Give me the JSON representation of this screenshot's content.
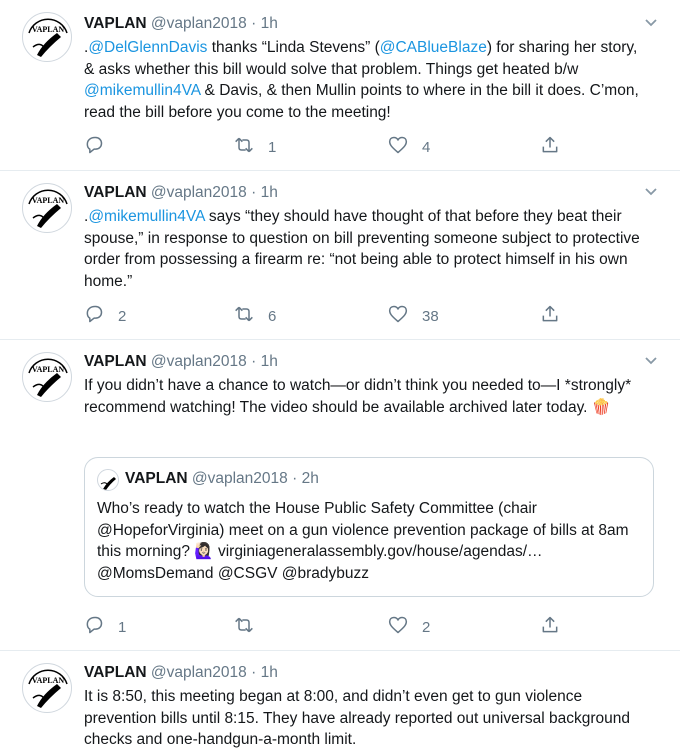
{
  "tweets": [
    {
      "name": "VAPLAN",
      "handle": "@vaplan2018",
      "dot": "·",
      "time": "1h",
      "body": [
        {
          "t": ".",
          "link": false
        },
        {
          "t": "@DelGlennDavis",
          "link": true
        },
        {
          "t": " thanks “Linda Stevens” (",
          "link": false
        },
        {
          "t": "@CABlueBlaze",
          "link": true
        },
        {
          "t": ") for sharing her story, & asks whether this bill would solve that problem. Things get heated b/w ",
          "link": false
        },
        {
          "t": "@mikemullin4VA",
          "link": true
        },
        {
          "t": " & Davis, & then Mullin points to where in the bill it does. C’mon, read the bill before you come to the meeting!",
          "link": false
        }
      ],
      "replies": "",
      "retweets": "1",
      "likes": "4"
    },
    {
      "name": "VAPLAN",
      "handle": "@vaplan2018",
      "dot": "·",
      "time": "1h",
      "body": [
        {
          "t": ".",
          "link": false
        },
        {
          "t": "@mikemullin4VA",
          "link": true
        },
        {
          "t": " says “they should have thought of that before they beat their spouse,” in response to question on bill preventing someone subject to protective order from possessing a firearm re: “not being able to protect himself in his own home.”",
          "link": false
        }
      ],
      "replies": "2",
      "retweets": "6",
      "likes": "38"
    },
    {
      "name": "VAPLAN",
      "handle": "@vaplan2018",
      "dot": "·",
      "time": "1h",
      "body": [
        {
          "t": "If you didn’t have a chance to watch—or didn’t think you needed to—I *strongly* recommend watching! The video should be available archived later today. 🍿",
          "link": false
        }
      ],
      "quote": {
        "name": "VAPLAN",
        "handle": "@vaplan2018",
        "dot": "·",
        "time": "2h",
        "body": "Who’s ready to watch the House Public Safety Committee (chair @HopeforVirginia) meet on a gun violence prevention package of bills at 8am this morning? 🙋🏻‍♀️ virginiageneralassembly.gov/house/agendas/… @MomsDemand @CSGV @bradybuzz"
      },
      "replies": "1",
      "retweets": "",
      "likes": "2"
    },
    {
      "name": "VAPLAN",
      "handle": "@vaplan2018",
      "dot": "·",
      "time": "1h",
      "body": [
        {
          "t": "It is 8:50, this meeting began at 8:00, and didn’t even get to gun violence prevention bills until 8:15. They have already reported out universal background checks and one-handgun-a-month limit.",
          "link": false
        }
      ],
      "replies": "",
      "retweets": "",
      "likes": ""
    }
  ],
  "icons": {
    "caret": "chevron-down-icon",
    "reply": "reply-icon",
    "retweet": "retweet-icon",
    "like": "heart-icon",
    "share": "share-icon"
  },
  "colors": {
    "link": "#1b95e0",
    "muted": "#657786",
    "divider": "#e6ecf0"
  }
}
